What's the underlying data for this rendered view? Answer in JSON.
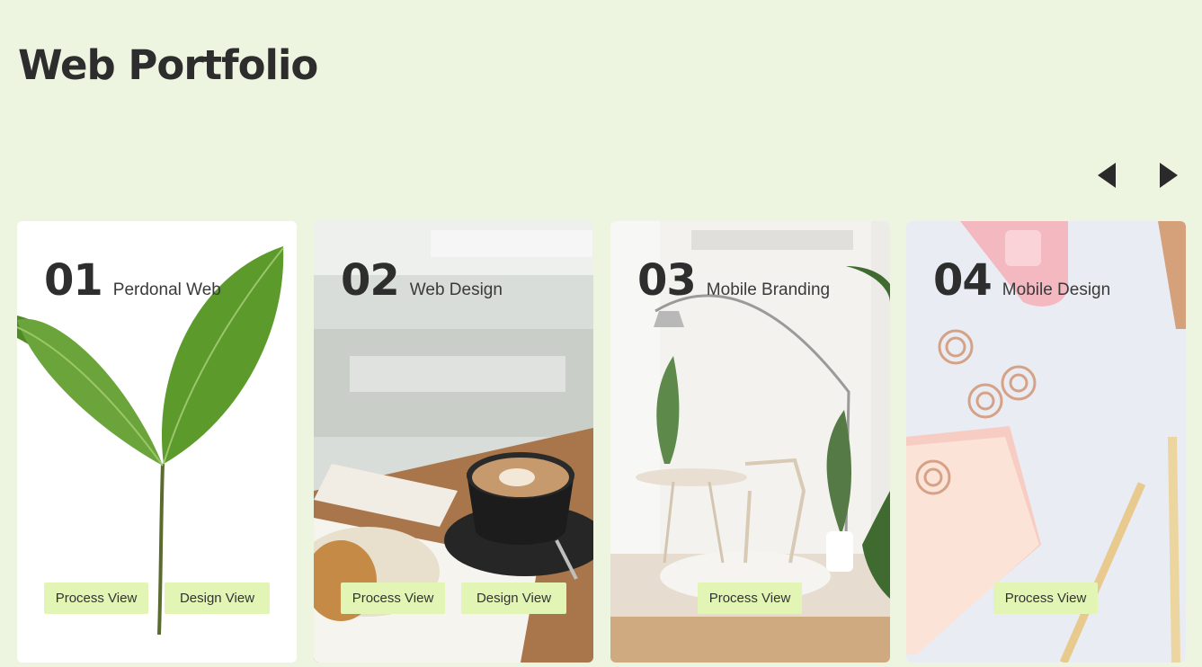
{
  "page": {
    "title": "Web Portfolio"
  },
  "carousel": {
    "prev_icon": "triangle-left-icon",
    "next_icon": "triangle-right-icon"
  },
  "cards": [
    {
      "number": "01",
      "label": "Perdonal Web",
      "image": "green-sprout-photo",
      "buttons": [
        "Process View",
        "Design View"
      ]
    },
    {
      "number": "02",
      "label": "Web Design",
      "image": "coffee-cup-photo",
      "buttons": [
        "Process View",
        "Design View"
      ]
    },
    {
      "number": "03",
      "label": "Mobile Branding",
      "image": "white-interior-photo",
      "buttons": [
        "Process View"
      ]
    },
    {
      "number": "04",
      "label": "Mobile Design",
      "image": "pink-stationery-photo",
      "buttons": [
        "Process View"
      ]
    }
  ],
  "colors": {
    "background": "#edf5e1",
    "button": "#e3f5b5",
    "text": "#2d2d2d"
  }
}
